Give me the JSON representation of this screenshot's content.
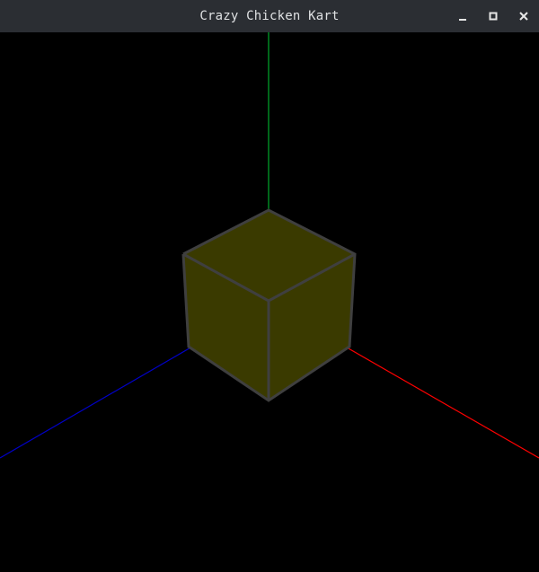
{
  "window": {
    "title": "Crazy Chicken Kart",
    "buttons": {
      "minimize": "minimize-icon",
      "maximize": "maximize-icon",
      "close": "close-icon"
    }
  },
  "scene": {
    "background": "#000000",
    "cube_color": "#3a3a00",
    "cube_edge_color": "#3f3f3f",
    "axis_x_color": "#ff0000",
    "axis_y_color": "#00cc33",
    "axis_z_color": "#0000c8"
  }
}
